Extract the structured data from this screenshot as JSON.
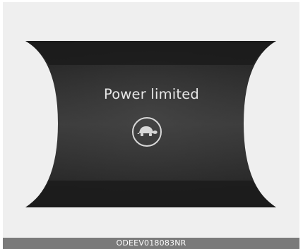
{
  "display": {
    "message": "Power limited",
    "icon": "turtle-icon"
  },
  "footer": {
    "code": "ODEEV018083NR"
  },
  "colors": {
    "background": "#efefef",
    "display_dark": "#2a2a2a",
    "display_mid": "#3a3a3a",
    "text": "#e7e7e7",
    "footer_bar": "#7a7a7a"
  }
}
